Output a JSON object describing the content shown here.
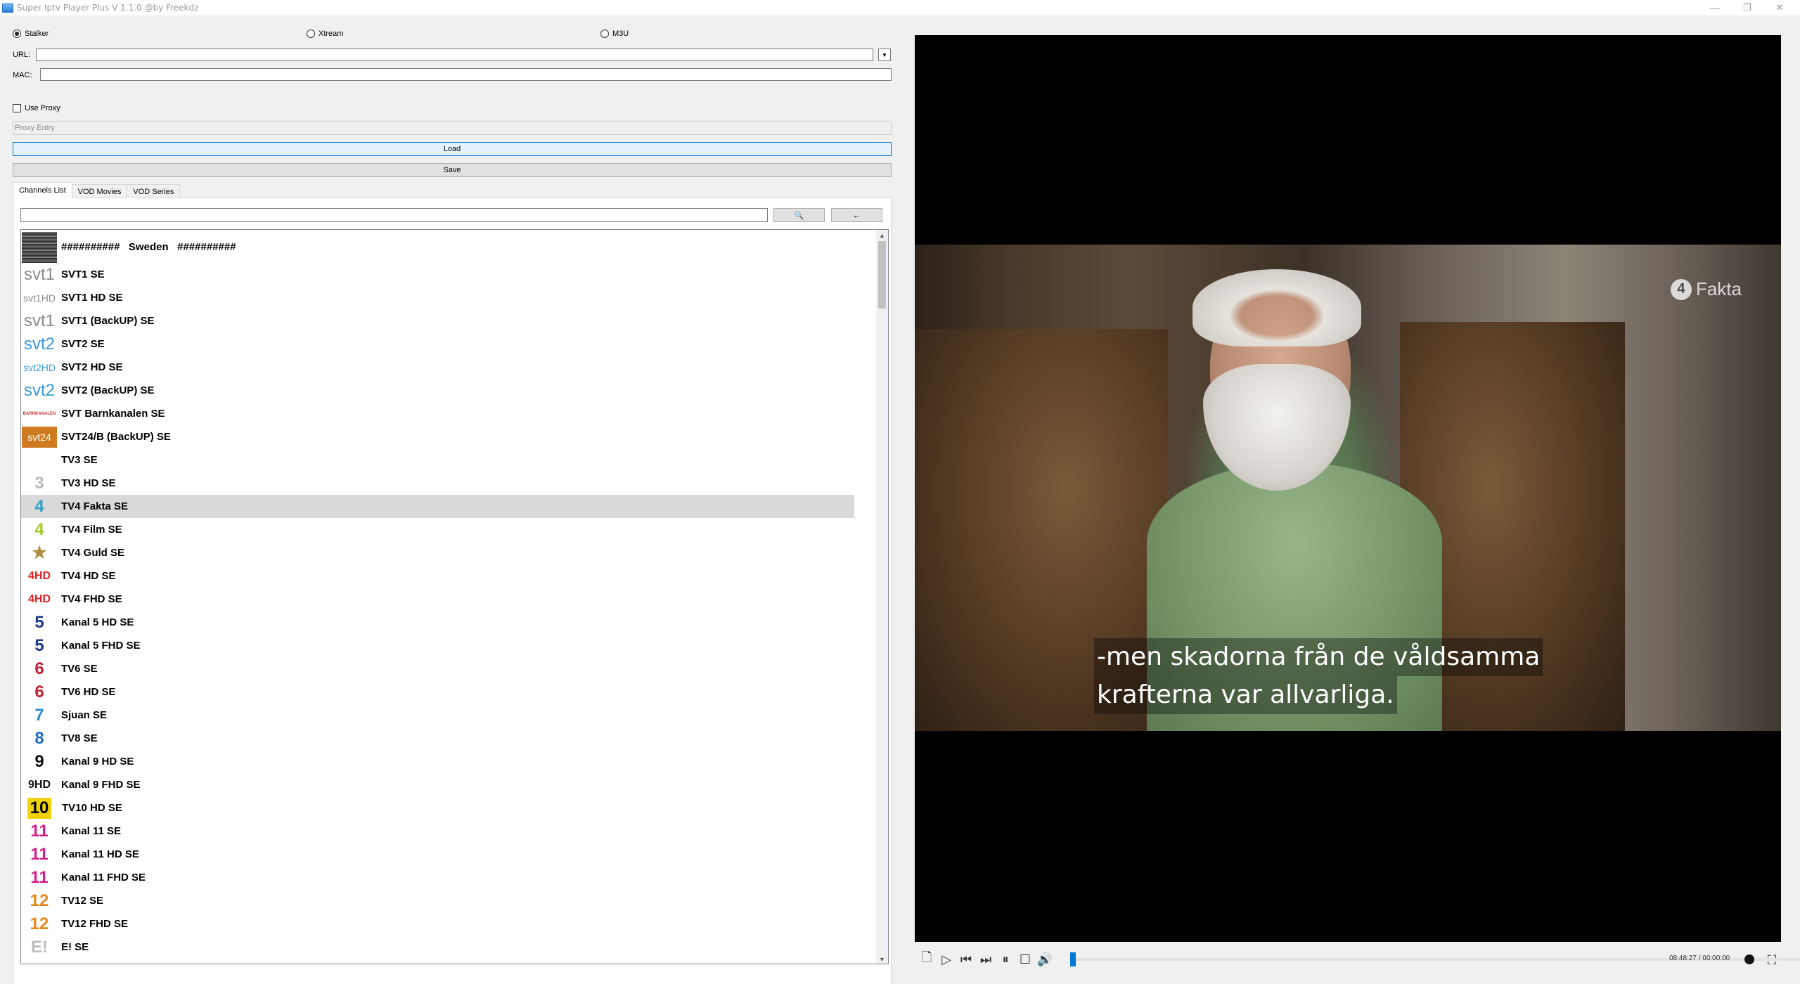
{
  "window": {
    "title": "Super Iptv Player Plus V 1.1.0 @by Freekdz",
    "minimize_glyph": "—",
    "restore_glyph": "❐",
    "close_glyph": "✕"
  },
  "modes": [
    {
      "label": "Stalker",
      "selected": true
    },
    {
      "label": "Xtream",
      "selected": false
    },
    {
      "label": "M3U",
      "selected": false
    }
  ],
  "form": {
    "url_label": "URL:",
    "url_value": "",
    "mac_label": "MAC:",
    "mac_value": "",
    "use_proxy_label": "Use Proxy",
    "use_proxy_checked": false,
    "proxy_placeholder": "Proxy Entry",
    "load_label": "Load",
    "save_label": "Save"
  },
  "tabs": [
    {
      "label": "Channels List",
      "active": true
    },
    {
      "label": "VOD Movies",
      "active": false
    },
    {
      "label": "VOD Series",
      "active": false
    }
  ],
  "search": {
    "value": "",
    "search_button_glyph": "🔍",
    "back_button_glyph": "←"
  },
  "channels": [
    {
      "name": "##########   Sweden   ##########",
      "logo_text": "",
      "logo_color": "#555555",
      "header": true
    },
    {
      "name": "SVT1 SE",
      "logo_text": "svt1",
      "logo_color": "#8a8a8a"
    },
    {
      "name": "SVT1 HD SE",
      "logo_text": "svt1HD",
      "logo_color": "#8a8a8a"
    },
    {
      "name": "SVT1 (BackUP) SE",
      "logo_text": "svt1",
      "logo_color": "#8a8a8a"
    },
    {
      "name": "SVT2 SE",
      "logo_text": "svt2",
      "logo_color": "#3a9ad9"
    },
    {
      "name": "SVT2 HD SE",
      "logo_text": "svt2HD",
      "logo_color": "#3a9ad9"
    },
    {
      "name": "SVT2 (BackUP) SE",
      "logo_text": "svt2",
      "logo_color": "#3a9ad9"
    },
    {
      "name": "SVT Barnkanalen SE",
      "logo_text": "BARNKANALEN",
      "logo_color": "#d03030"
    },
    {
      "name": "SVT24/B (BackUP) SE",
      "logo_text": "svt24",
      "logo_color": "#d07a20"
    },
    {
      "name": "TV3 SE",
      "logo_text": "",
      "logo_color": "#ffffff"
    },
    {
      "name": "TV3 HD SE",
      "logo_text": "3",
      "logo_color": "#bbbbbb"
    },
    {
      "name": "TV4 Fakta SE",
      "logo_text": "4",
      "logo_color": "#2aa0c8",
      "selected": true
    },
    {
      "name": "TV4 Film SE",
      "logo_text": "4",
      "logo_color": "#9acc20"
    },
    {
      "name": "TV4 Guld SE",
      "logo_text": "★",
      "logo_color": "#b08a40"
    },
    {
      "name": "TV4 HD SE",
      "logo_text": "4HD",
      "logo_color": "#e02020"
    },
    {
      "name": "TV4 FHD SE",
      "logo_text": "4HD",
      "logo_color": "#e02020"
    },
    {
      "name": "Kanal 5 HD SE",
      "logo_text": "5",
      "logo_color": "#1a3a8a"
    },
    {
      "name": "Kanal 5 FHD SE",
      "logo_text": "5",
      "logo_color": "#1a3a8a"
    },
    {
      "name": "TV6 SE",
      "logo_text": "6",
      "logo_color": "#c02030"
    },
    {
      "name": "TV6 HD SE",
      "logo_text": "6",
      "logo_color": "#c02030"
    },
    {
      "name": "Sjuan SE",
      "logo_text": "7",
      "logo_color": "#2a8ad0"
    },
    {
      "name": "TV8 SE",
      "logo_text": "8",
      "logo_color": "#2070c0"
    },
    {
      "name": "Kanal 9 HD SE",
      "logo_text": "9",
      "logo_color": "#111111"
    },
    {
      "name": "Kanal 9 FHD SE",
      "logo_text": "9HD",
      "logo_color": "#111111"
    },
    {
      "name": "TV10 HD SE",
      "logo_text": "10",
      "logo_color": "#f2d20a"
    },
    {
      "name": "Kanal 11 SE",
      "logo_text": "11",
      "logo_color": "#d0208a"
    },
    {
      "name": "Kanal 11 HD SE",
      "logo_text": "11",
      "logo_color": "#d0208a"
    },
    {
      "name": "Kanal 11 FHD SE",
      "logo_text": "11",
      "logo_color": "#d0208a"
    },
    {
      "name": "TV12 SE",
      "logo_text": "12",
      "logo_color": "#e88a20"
    },
    {
      "name": "TV12 FHD SE",
      "logo_text": "12",
      "logo_color": "#e88a20"
    },
    {
      "name": "E! SE",
      "logo_text": "E!",
      "logo_color": "#bbbbbb"
    }
  ],
  "video": {
    "channel_watermark_num": "4",
    "channel_watermark_text": "Fakta",
    "subtitle_line1": "-men skadorna från de våldsamma",
    "subtitle_line2": "krafterna var allvarliga."
  },
  "player": {
    "time_text": "08:48:27 / 00:00:00",
    "progress_fraction": 0.0,
    "icons": [
      "open-file-icon",
      "play-icon",
      "previous-icon",
      "next-icon",
      "pause-icon",
      "stop-icon",
      "volume-icon",
      "record-icon",
      "fullscreen-icon"
    ]
  }
}
